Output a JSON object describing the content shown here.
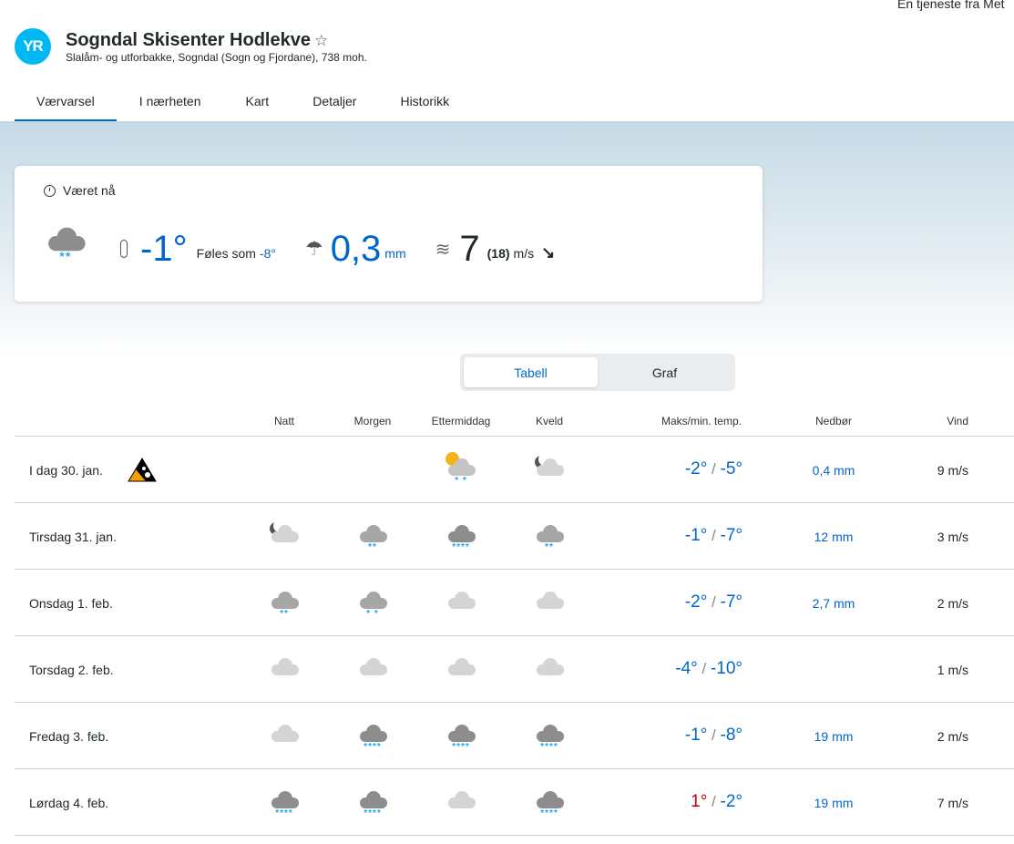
{
  "service_text": "En tjeneste fra Met",
  "logo": "YR",
  "location": {
    "title": "Sogndal Skisenter Hodlekve",
    "subtitle": "Slalåm- og utforbakke, Sogndal (Sogn og Fjordane), 738 moh."
  },
  "tabs": [
    "Værvarsel",
    "I nærheten",
    "Kart",
    "Detaljer",
    "Historikk"
  ],
  "now": {
    "heading": "Været nå",
    "icon": "cloud-snow",
    "temp": "-1°",
    "feels_label": "Føles som",
    "feels": "-8°",
    "precip": "0,3",
    "precip_unit": "mm",
    "wind": "7",
    "gust": "(18)",
    "wind_unit": "m/s",
    "wind_dir": "↘"
  },
  "toggle": {
    "table": "Tabell",
    "graph": "Graf"
  },
  "headers": {
    "night": "Natt",
    "morning": "Morgen",
    "afternoon": "Ettermiddag",
    "evening": "Kveld",
    "temp": "Maks/min. temp.",
    "precip": "Nedbør",
    "wind": "Vind"
  },
  "days": [
    {
      "label": "I dag 30. jan.",
      "warning": "avalanche-warning-orange",
      "icons": [
        null,
        null,
        "partly-sun-snow",
        "night-cloudy"
      ],
      "max": "-2°",
      "min": "-5°",
      "warm": false,
      "precip": "0,4 mm",
      "wind": "9 m/s"
    },
    {
      "label": "Tirsdag 31. jan.",
      "icons": [
        "night-cloudy",
        "snow-3",
        "snow-4",
        "snow-3"
      ],
      "max": "-1°",
      "min": "-7°",
      "warm": false,
      "precip": "12 mm",
      "wind": "3 m/s"
    },
    {
      "label": "Onsdag 1. feb.",
      "icons": [
        "snow-3",
        "snow-2",
        "cloud",
        "cloud"
      ],
      "max": "-2°",
      "min": "-7°",
      "warm": false,
      "precip": "2,7 mm",
      "wind": "2 m/s"
    },
    {
      "label": "Torsdag 2. feb.",
      "icons": [
        "cloud",
        "cloud",
        "cloud",
        "cloud"
      ],
      "max": "-4°",
      "min": "-10°",
      "warm": false,
      "precip": "",
      "wind": "1 m/s"
    },
    {
      "label": "Fredag 3. feb.",
      "icons": [
        "cloud",
        "snow-4",
        "snow-4",
        "snow-4"
      ],
      "max": "-1°",
      "min": "-8°",
      "warm": false,
      "precip": "19 mm",
      "wind": "2 m/s"
    },
    {
      "label": "Lørdag 4. feb.",
      "icons": [
        "snow-4",
        "snow-4",
        "cloud",
        "snow-4"
      ],
      "max": "1°",
      "min": "-2°",
      "warm": true,
      "precip": "19 mm",
      "wind": "7 m/s"
    }
  ]
}
